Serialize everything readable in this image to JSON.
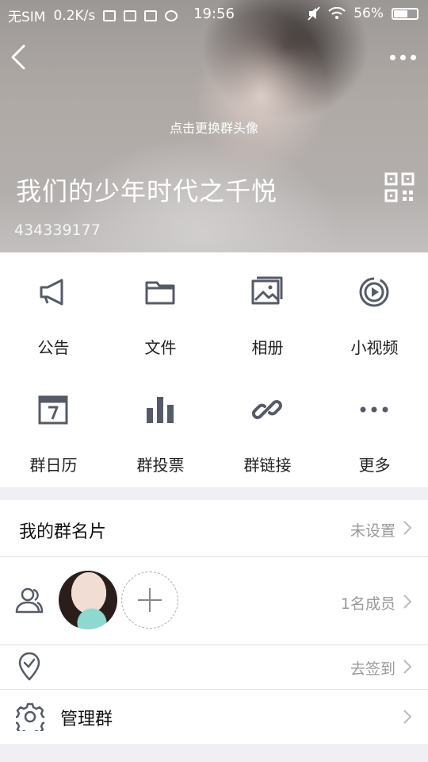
{
  "status_bar": {
    "carrier": "无SIM",
    "speed": "0.2K/s",
    "time": "19:56",
    "battery": "56%"
  },
  "header": {
    "change_avatar_hint": "点击更换群头像",
    "group_name": "我们的少年时代之千悦",
    "group_id": "434339177",
    "icons": [
      "back-icon",
      "more-icon",
      "qr-code-icon"
    ]
  },
  "features": [
    {
      "label": "公告",
      "icon": "megaphone-icon"
    },
    {
      "label": "文件",
      "icon": "folder-icon"
    },
    {
      "label": "相册",
      "icon": "album-icon"
    },
    {
      "label": "小视频",
      "icon": "video-icon"
    },
    {
      "label": "群日历",
      "icon": "calendar-icon"
    },
    {
      "label": "群投票",
      "icon": "vote-icon"
    },
    {
      "label": "群链接",
      "icon": "link-icon"
    },
    {
      "label": "更多",
      "icon": "more-dots-icon"
    }
  ],
  "card": {
    "title": "我的群名片",
    "value": "未设置"
  },
  "members": {
    "count_text": "1名成员"
  },
  "checkin": {
    "value": "去签到"
  },
  "manage": {
    "title": "管理群"
  },
  "colors": {
    "icon": "#555b66",
    "text_secondary": "#999999",
    "background": "#efeff4"
  }
}
